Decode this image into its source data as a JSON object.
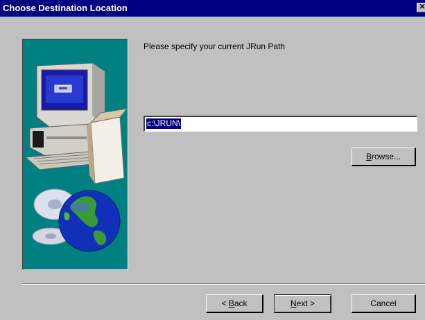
{
  "window": {
    "title": "Choose Destination Location",
    "close_glyph": "✕"
  },
  "sidebar": {
    "image": "computer-and-globe-illustration",
    "background": "#008080"
  },
  "main": {
    "prompt": "Please specify your current JRun Path",
    "path_value": "c:\\JRUN\\",
    "browse_label_accel": "B",
    "browse_label_rest": "rowse..."
  },
  "footer": {
    "back_prefix": "< ",
    "back_accel": "B",
    "back_rest": "ack",
    "next_accel": "N",
    "next_rest": "ext >",
    "cancel_label": "Cancel"
  },
  "colors": {
    "titlebar": "#000080",
    "face": "#c0c0c0",
    "selection": "#000080"
  }
}
